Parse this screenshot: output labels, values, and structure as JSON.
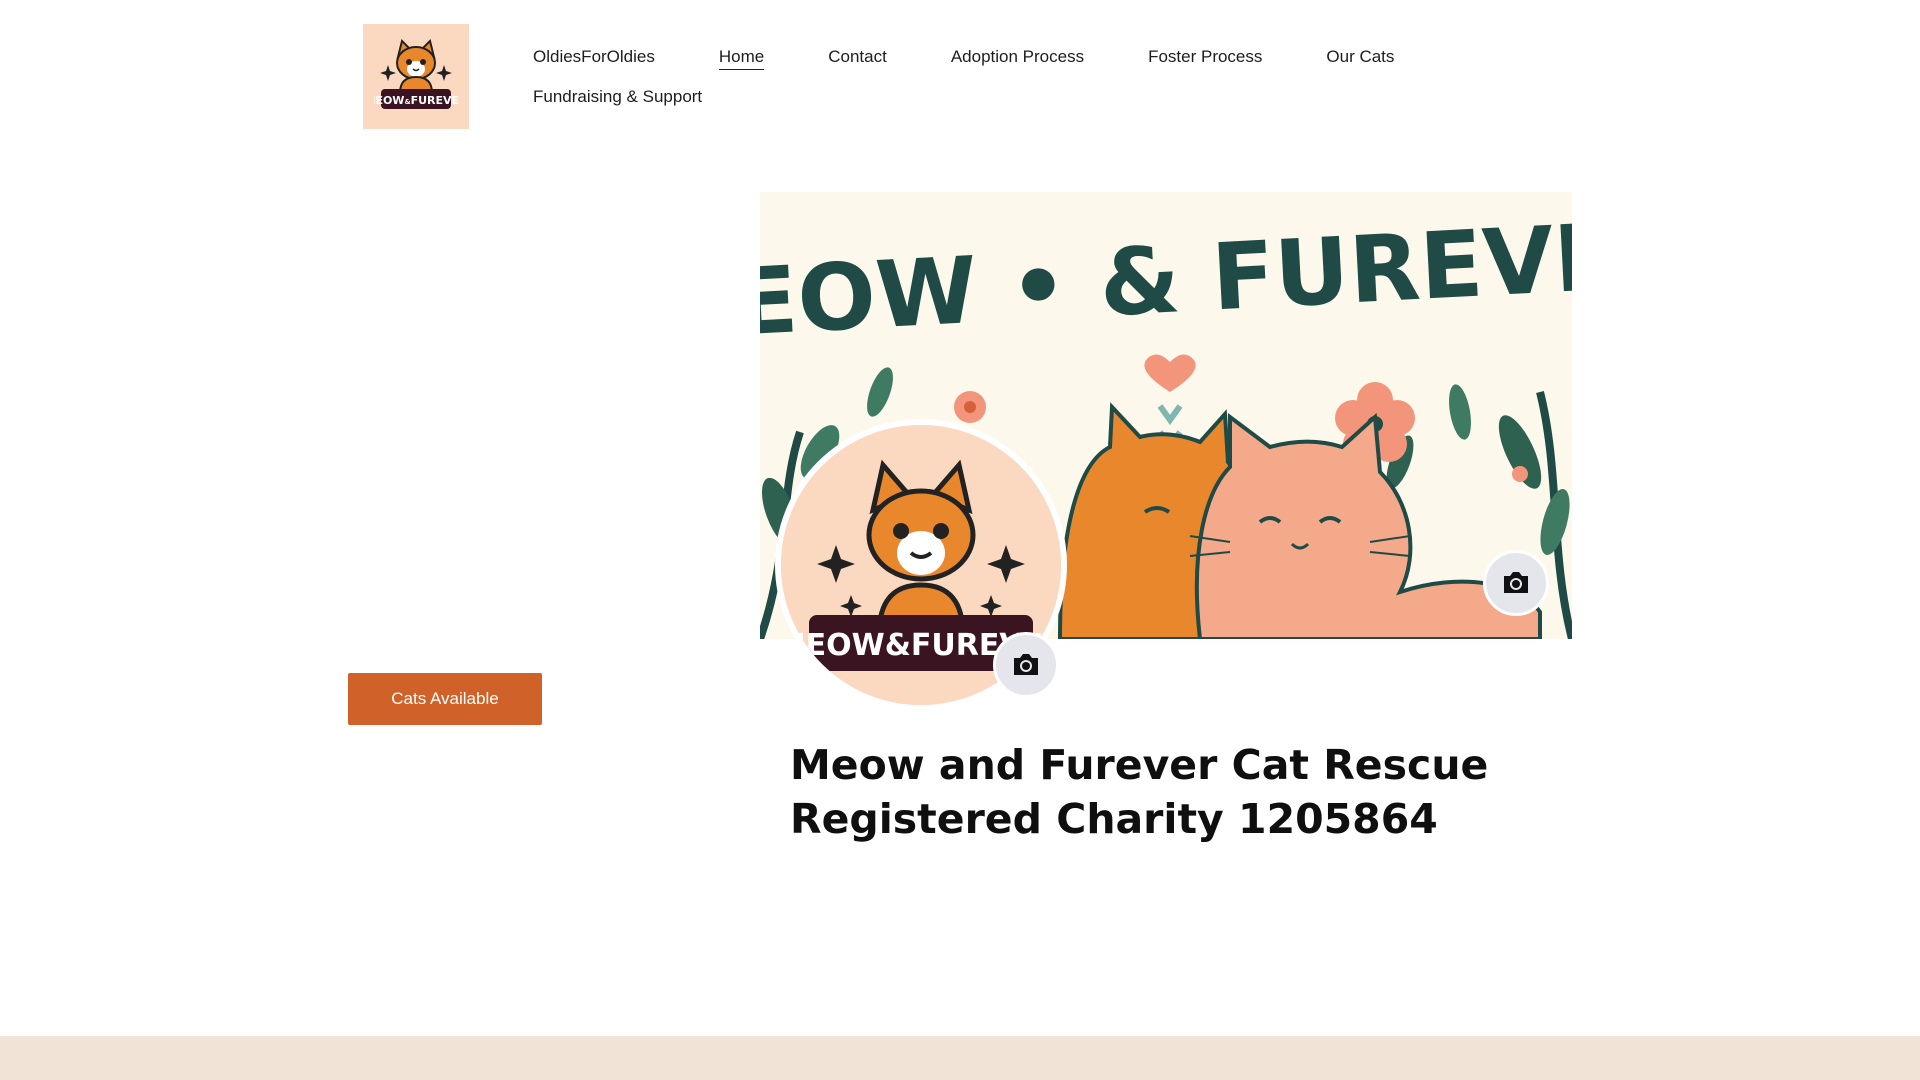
{
  "brand": {
    "logo_text_top": "MEOW",
    "logo_text_amp": "&",
    "logo_text_bottom": "FUREVER",
    "logo_bg": "#fbd8c0"
  },
  "nav": {
    "items": [
      {
        "label": "OldiesForOldies",
        "active": false
      },
      {
        "label": "Home",
        "active": true
      },
      {
        "label": "Contact",
        "active": false
      },
      {
        "label": "Adoption Process",
        "active": false
      },
      {
        "label": "Foster Process",
        "active": false
      },
      {
        "label": "Our Cats",
        "active": false
      },
      {
        "label": "Fundraising & Support",
        "active": false
      }
    ]
  },
  "cta": {
    "label": "Cats Available",
    "color": "#d06128"
  },
  "hero": {
    "cover_title": "MEOW • & FUREVER",
    "profile_logo_text": "MEOW&FUREVER",
    "page_name_line1": "Meow and Furever Cat Rescue",
    "page_name_line2": "Registered Charity 1205864",
    "cover_camera_icon": "camera-icon",
    "profile_camera_icon": "camera-icon"
  },
  "colors": {
    "accent": "#d06128",
    "footer": "#f1e4d6",
    "dark_green": "#1f4a45",
    "cat_orange": "#e9872d",
    "cat_peach": "#f4a98a"
  }
}
